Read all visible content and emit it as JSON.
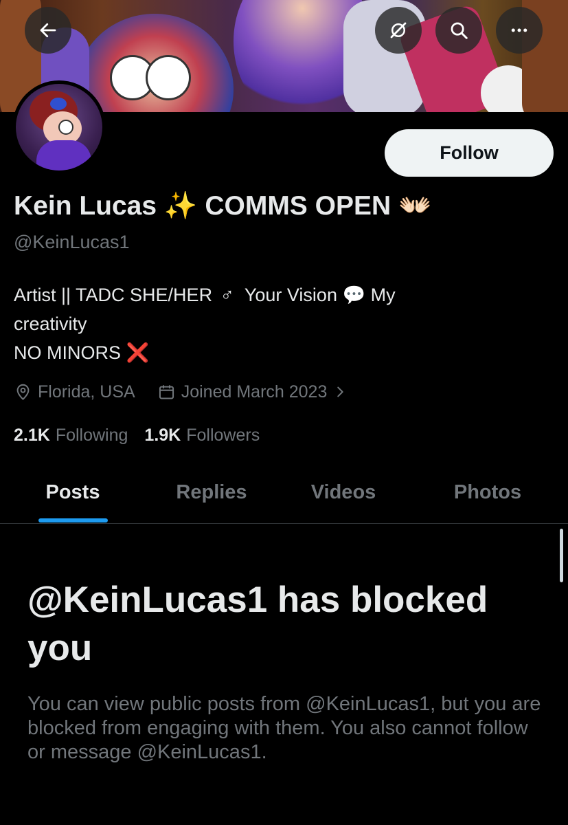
{
  "header": {
    "back_icon": "back-arrow-icon",
    "grok_icon": "grok-icon",
    "search_icon": "search-icon",
    "more_icon": "more-icon"
  },
  "profile": {
    "follow_label": "Follow",
    "display_name": "Kein Lucas",
    "display_name_suffix": "COMMS OPEN",
    "sparkles_emoji": "✨",
    "hands_emoji": "👐🏻",
    "handle": "@KeinLucas1",
    "bio": {
      "line1_a": "Artist || TADC SHE/HER",
      "male_sign": "♂",
      "line1_b": "Your Vision",
      "speech_emoji": "💬",
      "line1_c": "My",
      "line2": "creativity",
      "line3": "NO MINORS",
      "cross_emoji": "❌"
    },
    "location": "Florida, USA",
    "joined": "Joined March 2023",
    "following_count": "2.1K",
    "following_label": "Following",
    "followers_count": "1.9K",
    "followers_label": "Followers"
  },
  "tabs": [
    {
      "label": "Posts",
      "active": true
    },
    {
      "label": "Replies",
      "active": false
    },
    {
      "label": "Videos",
      "active": false
    },
    {
      "label": "Photos",
      "active": false
    }
  ],
  "blocked": {
    "title": "@KeinLucas1 has blocked you",
    "message": "You can view public posts from @KeinLucas1, but you are blocked from engaging with them. You also cannot follow or message @KeinLucas1."
  },
  "colors": {
    "background": "#000000",
    "text_primary": "#e7e9ea",
    "text_secondary": "#71767b",
    "accent": "#1d9bf0",
    "follow_bg": "#eff3f4"
  }
}
